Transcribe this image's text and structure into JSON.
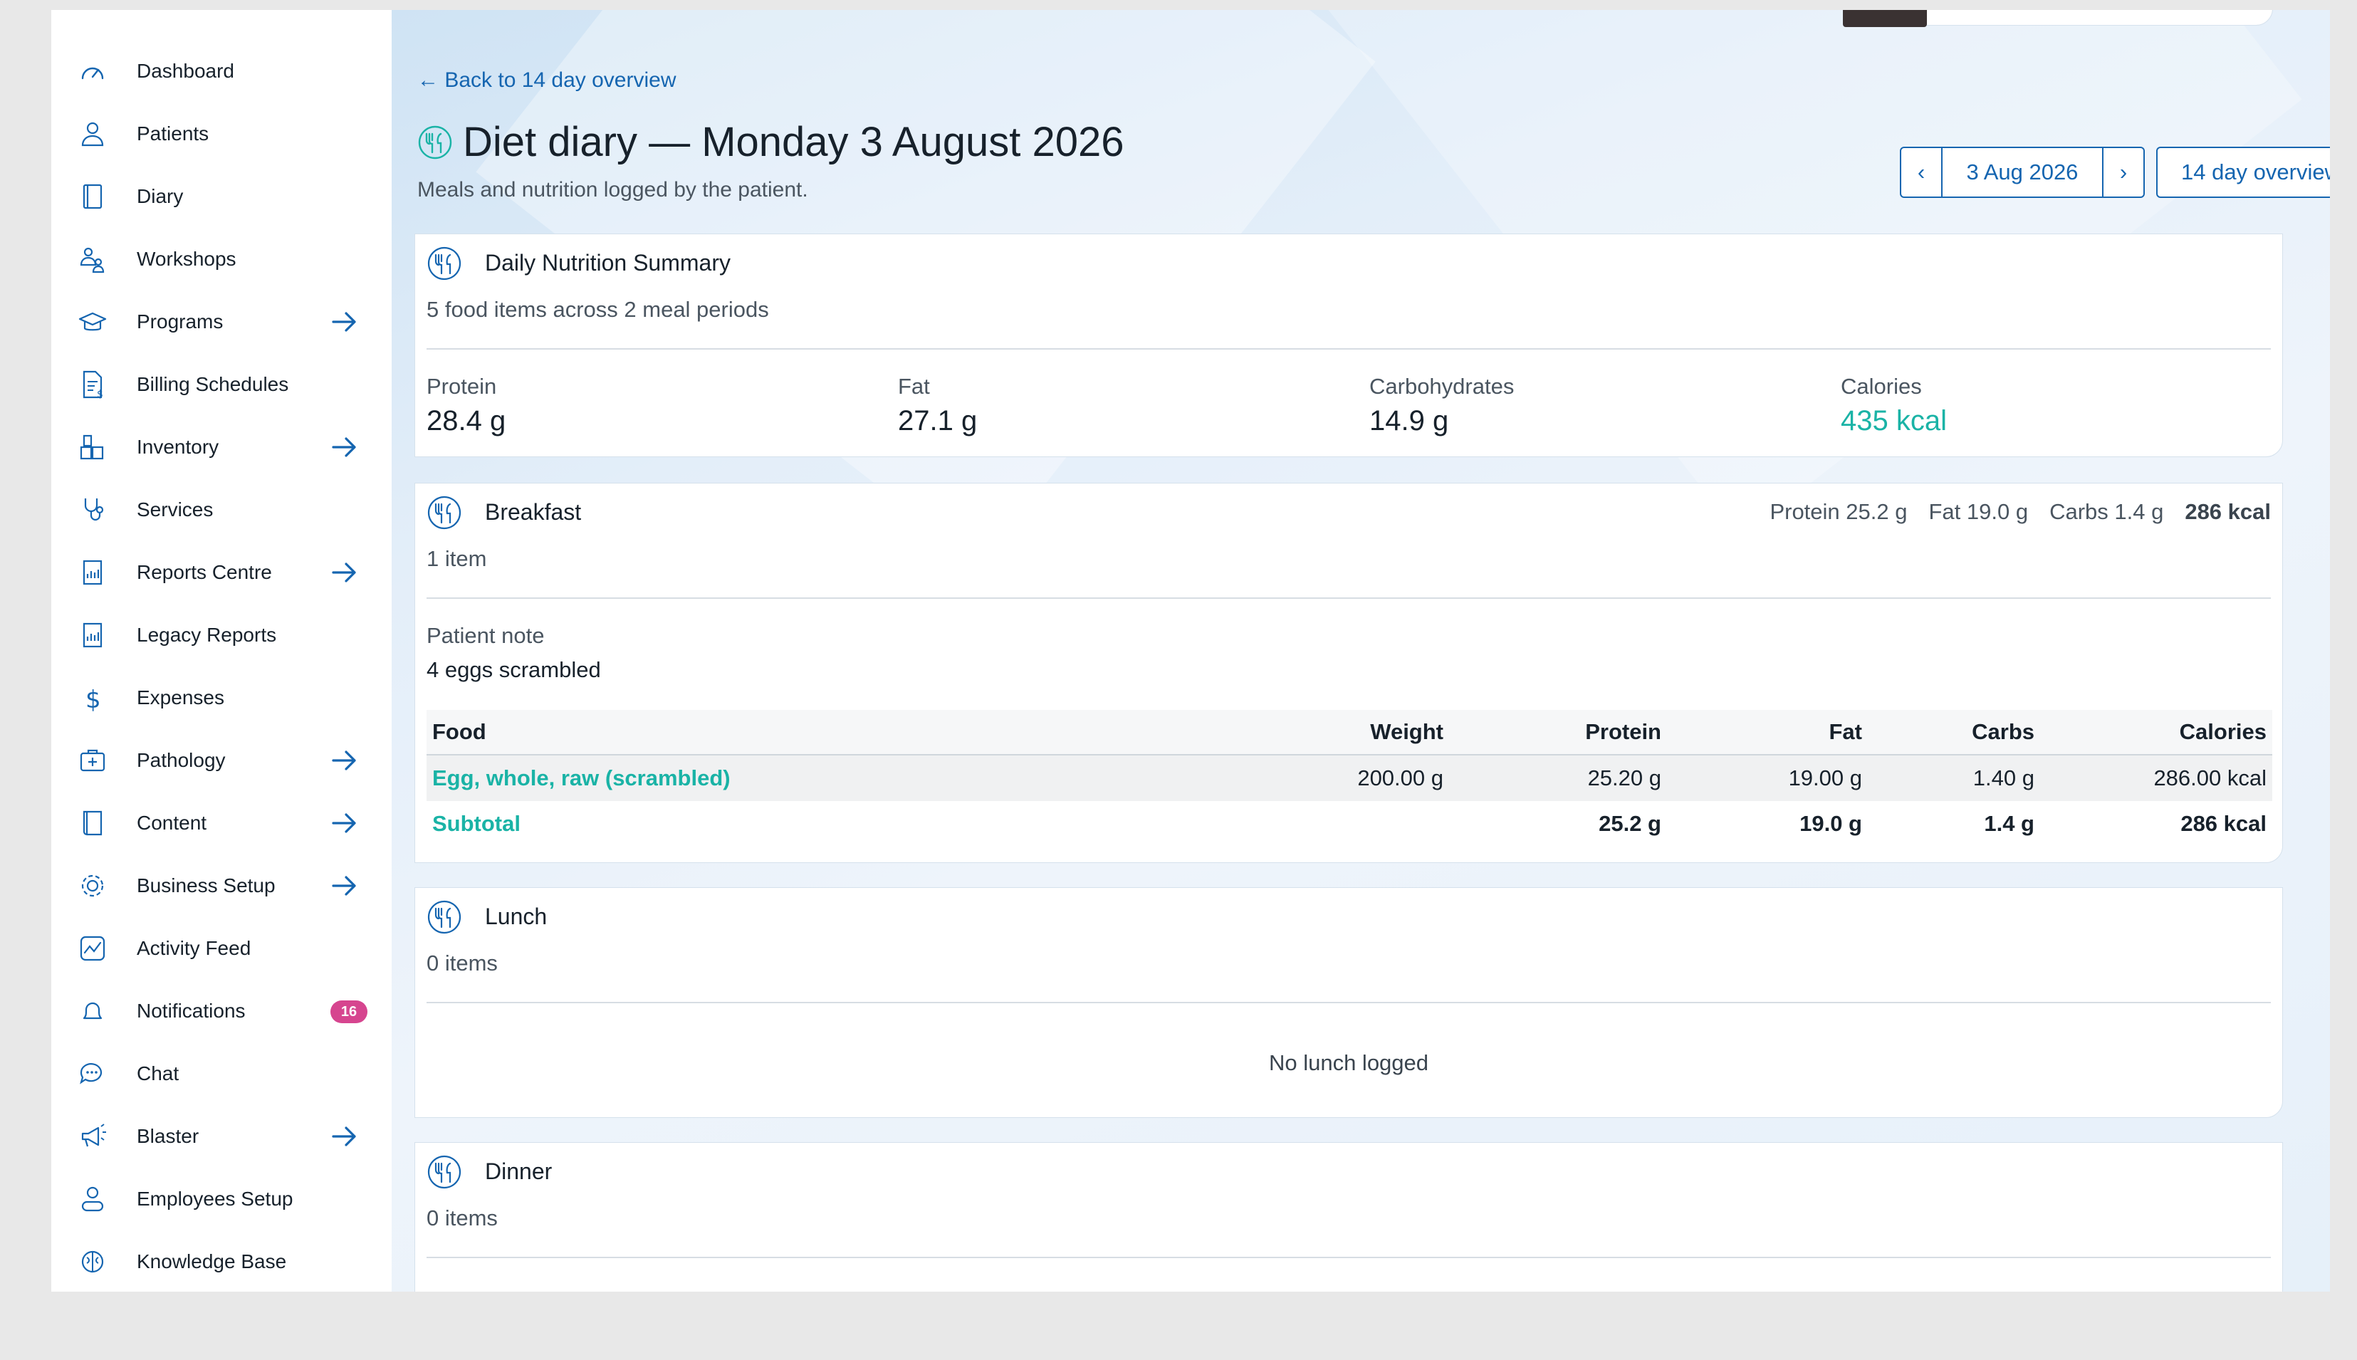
{
  "sidebar": {
    "items": [
      {
        "label": "Dashboard",
        "icon": "gauge-icon",
        "arrow": false
      },
      {
        "label": "Patients",
        "icon": "user-icon",
        "arrow": false
      },
      {
        "label": "Diary",
        "icon": "notebook-icon",
        "arrow": false
      },
      {
        "label": "Workshops",
        "icon": "people-icon",
        "arrow": false
      },
      {
        "label": "Programs",
        "icon": "graduation-cap-icon",
        "arrow": true
      },
      {
        "label": "Billing Schedules",
        "icon": "billing-icon",
        "arrow": false
      },
      {
        "label": "Inventory",
        "icon": "boxes-icon",
        "arrow": true
      },
      {
        "label": "Services",
        "icon": "stethoscope-icon",
        "arrow": false
      },
      {
        "label": "Reports Centre",
        "icon": "report-icon",
        "arrow": true
      },
      {
        "label": "Legacy Reports",
        "icon": "report-icon",
        "arrow": false
      },
      {
        "label": "Expenses",
        "icon": "dollar-icon",
        "arrow": false
      },
      {
        "label": "Pathology",
        "icon": "medical-kit-icon",
        "arrow": true
      },
      {
        "label": "Content",
        "icon": "book-icon",
        "arrow": true
      },
      {
        "label": "Business Setup",
        "icon": "gear-icon",
        "arrow": true
      },
      {
        "label": "Activity Feed",
        "icon": "activity-icon",
        "arrow": false
      },
      {
        "label": "Notifications",
        "icon": "bell-icon",
        "arrow": false,
        "badge": "16"
      },
      {
        "label": "Chat",
        "icon": "chat-icon",
        "arrow": false
      },
      {
        "label": "Blaster",
        "icon": "megaphone-icon",
        "arrow": true
      },
      {
        "label": "Employees Setup",
        "icon": "employee-icon",
        "arrow": false
      },
      {
        "label": "Knowledge Base",
        "icon": "brain-icon",
        "arrow": false
      }
    ]
  },
  "header": {
    "back_link": "← Back to 14 day overview",
    "title": "Diet diary — Monday 3 August 2026",
    "subtitle": "Meals and nutrition logged by the patient.",
    "prev_label": "‹",
    "date_label": "3 Aug 2026",
    "next_label": "›",
    "overview_label": "14 day overview"
  },
  "summary": {
    "title": "Daily Nutrition Summary",
    "subtitle": "5 food items across 2 meal periods",
    "stats": [
      {
        "label": "Protein",
        "value": "28.4 g"
      },
      {
        "label": "Fat",
        "value": "27.1 g"
      },
      {
        "label": "Carbohydrates",
        "value": "14.9 g"
      },
      {
        "label": "Calories",
        "value": "435 kcal"
      }
    ]
  },
  "breakfast": {
    "title": "Breakfast",
    "count": "1 item",
    "summary_protein": "Protein 25.2 g",
    "summary_fat": "Fat 19.0 g",
    "summary_carbs": "Carbs 1.4 g",
    "summary_kcal": "286 kcal",
    "note_label": "Patient note",
    "note_text": "4 eggs scrambled",
    "columns": [
      "Food",
      "Weight",
      "Protein",
      "Fat",
      "Carbs",
      "Calories"
    ],
    "rows": [
      {
        "food": "Egg, whole, raw (scrambled)",
        "weight": "200.00 g",
        "protein": "25.20 g",
        "fat": "19.00 g",
        "carbs": "1.40 g",
        "calories": "286.00 kcal"
      }
    ],
    "subtotal": {
      "label": "Subtotal",
      "protein": "25.2 g",
      "fat": "19.0 g",
      "carbs": "1.4 g",
      "calories": "286 kcal"
    }
  },
  "lunch": {
    "title": "Lunch",
    "count": "0 items",
    "empty": "No lunch logged"
  },
  "dinner": {
    "title": "Dinner",
    "count": "0 items"
  },
  "colors": {
    "accent": "#1565b0",
    "teal": "#1ab3a6",
    "badge": "#d6458f"
  }
}
